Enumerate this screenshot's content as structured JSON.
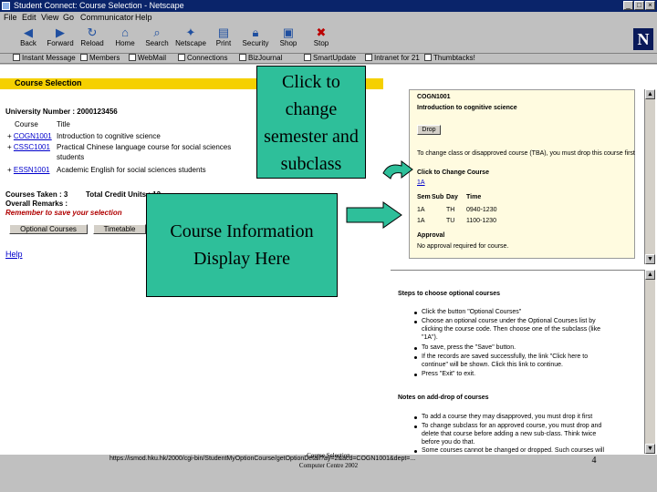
{
  "window": {
    "title": "Student Connect: Course Selection - Netscape",
    "minimize": "_",
    "maximize": "□",
    "close": "×"
  },
  "menu": [
    "File",
    "Edit",
    "View",
    "Go",
    "Communicator",
    "Help"
  ],
  "toolbar": [
    {
      "label": "Back",
      "icon": "back-arrow-icon"
    },
    {
      "label": "Forward",
      "icon": "forward-arrow-icon"
    },
    {
      "label": "Reload",
      "icon": "reload-icon"
    },
    {
      "label": "Home",
      "icon": "home-icon"
    },
    {
      "label": "Search",
      "icon": "search-icon"
    },
    {
      "label": "Netscape",
      "icon": "netscape-icon"
    },
    {
      "label": "Print",
      "icon": "print-icon"
    },
    {
      "label": "Security",
      "icon": "security-icon"
    },
    {
      "label": "Shop",
      "icon": "shop-icon"
    },
    {
      "label": "Stop",
      "icon": "stop-icon"
    }
  ],
  "logo": "N",
  "personal_toolbar": [
    "Instant Message",
    "Members",
    "WebMail",
    "Connections",
    "BizJournal",
    "SmartUpdate",
    "Intranet for 21",
    "Thumbtacks!"
  ],
  "page": {
    "banner": "Course Selection",
    "university_number": "University Number : 2000123456",
    "col_course": "Course",
    "col_title": "Title",
    "courses": [
      {
        "prefix": "+",
        "code": "COGN1001",
        "title": "Introduction to cognitive science"
      },
      {
        "prefix": "+",
        "code": "CSSC1001",
        "title": "Practical Chinese language course for social sciences"
      },
      {
        "prefix": "",
        "code": "",
        "title": "students"
      },
      {
        "prefix": "+",
        "code": "ESSN1001",
        "title": "Academic English for social sciences students"
      }
    ],
    "courses_taken": "Courses Taken : 3",
    "total_credit": "Total Credit Units : 12",
    "overall_remarks": "Overall Remarks :",
    "reminder": "Remember to save your selection",
    "optional_courses_button": "Optional Courses",
    "timetable_button": "Timetable",
    "help_link": "Help"
  },
  "info_panel": {
    "code": "COGN1001",
    "title": "Introduction to cognitive science",
    "drop_button": "Drop",
    "note": "To change class or disapproved course (TBA), you must drop this course first",
    "change_link": "Click to Change Course",
    "subclass": "1A",
    "table_head": [
      "Sem",
      "Sub",
      "Day",
      "Time"
    ],
    "table_rows": [
      [
        "1A",
        "",
        "TH",
        "0940-1230"
      ],
      [
        "1A",
        "",
        "TU",
        "1100-1230"
      ]
    ],
    "approval_label": "Approval",
    "approval_text": "No approval required for course."
  },
  "help_panel": {
    "steps_title": "Steps to choose optional courses",
    "steps": [
      "Click the button \"Optional Courses\"",
      "Choose an optional course under the Optional Courses list by",
      "clicking the course code. Then choose one of the subclass (like",
      "\"1A\").",
      "To save, press the \"Save\" button.",
      "If the records are saved successfully, the link \"Click here to",
      "continue\" will be shown. Click this link to continue.",
      "Press \"Exit\" to exit."
    ],
    "notes_title": "Notes on add-drop of courses",
    "notes": [
      "To add a course they may disapproved, you must drop it first",
      "To change subclass for an approved course, you must drop and",
      "delete that course before adding a new sub-class. Think twice",
      "before you do that.",
      "Some courses cannot be changed or dropped. Such courses will"
    ]
  },
  "status_url": "https://ismod.hku.hk/2000/cgi-bin/StudentMyOptionCourse/getOptionDetail?ay=2&acd=COGN1001&dept=...",
  "callouts": {
    "semester": "Click to change semester and subclass",
    "course_info": "Course Information Display Here"
  },
  "footer": {
    "line1": "Course Selection",
    "line2": "Computer Centre 2002",
    "page_number": "4"
  },
  "colors": {
    "titlebar": "#0a246a",
    "banner": "#f5d000",
    "callout": "#2ebf9a",
    "info_panel": "#fffbe0"
  }
}
